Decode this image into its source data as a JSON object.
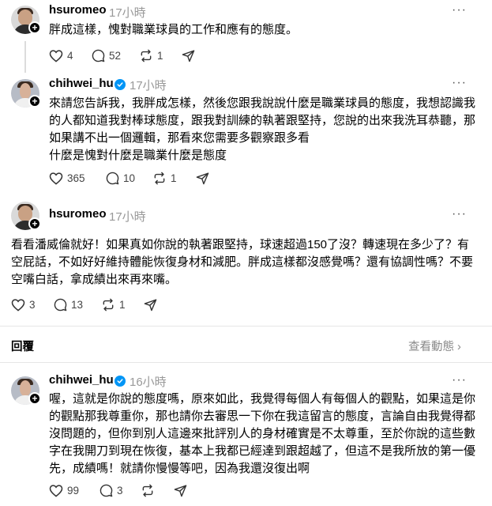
{
  "posts": [
    {
      "username": "hsuromeo",
      "time": "17小時",
      "text": "胖成這樣，愧對職業球員的工作和應有的態度。",
      "likes": "4",
      "comments": "52",
      "reposts": "1",
      "verified": false
    },
    {
      "username": "chihwei_hu",
      "time": "17小時",
      "text": "來請您告訴我，我胖成怎樣，然後您跟我說說什麼是職業球員的態度，我想認識我\n的人都知道我對棒球態度，跟我對訓練的執著跟堅持，您說的出來我洗耳恭聽，那\n如果講不出一個邏輯，那看來您需要多觀察跟多看\n什麼是愧對什麼是職業什麼是態度",
      "likes": "365",
      "comments": "10",
      "reposts": "1",
      "verified": true
    },
    {
      "username": "hsuromeo",
      "time": "17小時",
      "text": "看看潘威倫就好！如果真如你說的執著跟堅持，球速超過150了沒？轉速現在多少了？有\n空屁話，不如好好維持體能恢復身材和減肥。胖成這樣都沒感覺嗎？還有協調性嗎？不要\n空嘴白話，拿成績出來再來嘴。",
      "likes": "3",
      "comments": "13",
      "reposts": "1",
      "verified": false
    },
    {
      "username": "chihwei_hu",
      "time": "16小時",
      "text": "喔，這就是你說的態度嗎，原來如此，我覺得每個人有每個人的觀點，如果這是你\n的觀點那我尊重你，那也請你去審思一下你在我這留言的態度，言論自由我覺得都\n沒問題的，但你到別人這邊來批評別人的身材確實是不太尊重，至於你說的這些數\n字在我開刀到現在恢復，基本上我都已經達到跟超越了，但這不是我所放的第一優\n先，成績嗎！就請你慢慢等吧，因為我還沒復出啊",
      "likes": "99",
      "comments": "3",
      "reposts": "",
      "verified": true
    }
  ],
  "reply_section": {
    "label": "回覆",
    "activity_link": "查看動態 ›"
  },
  "colors": {
    "verified": "#0095f6",
    "muted": "#999999",
    "divider": "#e6e6e6"
  },
  "icons": [
    "heart-icon",
    "comment-icon",
    "repost-icon",
    "share-icon",
    "more-icon",
    "verified-badge-icon",
    "follow-plus-icon"
  ]
}
